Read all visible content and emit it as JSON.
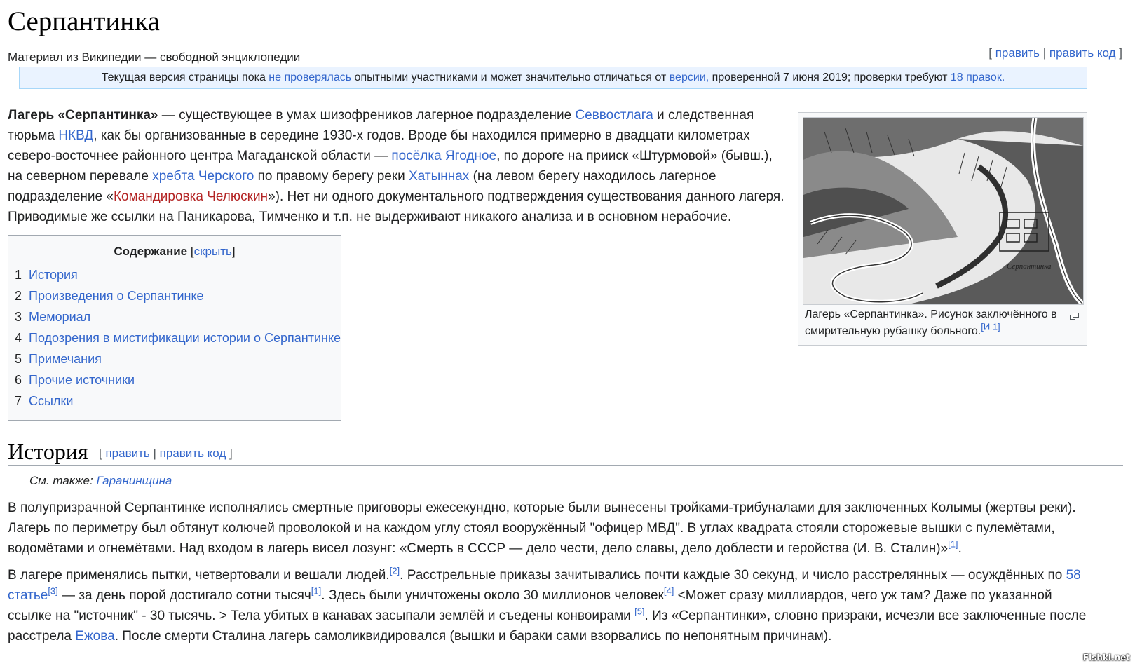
{
  "page": {
    "title": "Серпантинка",
    "subtitle": "Материал из Википедии — свободной энциклопедии",
    "edit": {
      "open": "[",
      "edit_label": "править",
      "sep": "|",
      "edit_code_label": "править код",
      "close": "]"
    }
  },
  "notice": {
    "t1": "Текущая версия страницы пока ",
    "l1": "не проверялась",
    "t2": " опытными участниками и может значительно отличаться от ",
    "l2": "версии,",
    "t3": " проверенной 7 июня 2019; проверки требуют ",
    "l3": "18 правок."
  },
  "lead": {
    "bold": "Лагерь «Серпантинка»",
    "t1": " — существующее в умах шизофреников лагерное подразделение ",
    "l1": "Севвостлага",
    "t2": " и следственная тюрьма ",
    "l2": "НКВД",
    "t3": ", как бы организованные в середине 1930-х годов. Вроде бы находился примерно в двадцати километрах северо-восточнее районного центра Магаданской области — ",
    "l3": "посёлка Ягодное",
    "t4": ", по дороге на прииск «Штурмовой» (бывш.), на северном перевале ",
    "l4": "хребта Черского",
    "t5": " по правому берегу реки ",
    "l5": "Хатыннах",
    "t6": " (на левом берегу находилось лагерное подразделение «",
    "l6": "Командировка Челюскин",
    "t7": "»). Нет ни одного документального подтверждения существования данного лагеря. Приводимые же ссылки на Паникарова, Тимченко и т.п. не выдерживают никакого анализа и в основном нерабочие."
  },
  "thumb": {
    "caption": "Лагерь «Серпантинка». Рисунок заключённого в смирительную рубашку больного.",
    "ref": "[И 1]",
    "signature": "Серпантинка"
  },
  "toc": {
    "title": "Содержание",
    "toggle_open": "[",
    "toggle": "скрыть",
    "toggle_close": "]",
    "items": [
      {
        "num": "1",
        "label": "История"
      },
      {
        "num": "2",
        "label": "Произведения о Серпантинке"
      },
      {
        "num": "3",
        "label": "Мемориал"
      },
      {
        "num": "4",
        "label": "Подозрения в мистификации истории о Серпантинке"
      },
      {
        "num": "5",
        "label": "Примечания"
      },
      {
        "num": "6",
        "label": "Прочие источники"
      },
      {
        "num": "7",
        "label": "Ссылки"
      }
    ]
  },
  "history": {
    "heading": "История",
    "edit": {
      "open": "[",
      "edit_label": "править",
      "sep": "|",
      "edit_code_label": "править код",
      "close": "]"
    },
    "hatnote_prefix": "См. также: ",
    "hatnote_link": "Гаранинщина",
    "p1": {
      "text": "В полупризрачной Серпантинке исполнялись смертные приговоры ежесекундно, которые были вынесены тройками-трибуналами для заключенных Колымы (жертвы реки). Лагерь по периметру был обтянут колючей проволокой и на каждом углу стоял вооружённый \"офицер МВД\". В углах квадрата стояли сторожевые вышки с пулемётами, водомётами и огнемётами. Над входом в лагерь висел лозунг: «Смерть в СССР — дело чести, дело славы, дело доблести и геройства (И. В. Сталин)»",
      "ref1": "[1]",
      "end": "."
    },
    "p2": {
      "t1": "В лагере применялись пытки, четвертовали и вешали людей.",
      "r1": "[2]",
      "t2": ". Расстрельные приказы зачитывались почти каждые 30 секунд, и число расстрелянных — осуждённых по ",
      "l1": "58 статье",
      "r2": "[3]",
      "t3": " — за день порой достигало сотни тысяч",
      "r3": "[1]",
      "t4": ". Здесь были уничтожены около 30 миллионов человек",
      "r4": "[4]",
      "t5": " <Может сразу миллиардов, чего уж там? Даже по указанной ссылке на \"источник\" - 30 тысячь. > Тела убитых в канавах засыпали землёй и съедены конвоирами ",
      "r5": "[5]",
      "t6": ". Из «Серпантинки», словно призраки, исчезли все заключенные после расстрела ",
      "l2": "Ежова",
      "t7": ". После смерти Сталина лагерь самоликвидировался (вышки и бараки сами взорвались по непонятным причинам)."
    }
  },
  "watermark": "Fishki.net"
}
